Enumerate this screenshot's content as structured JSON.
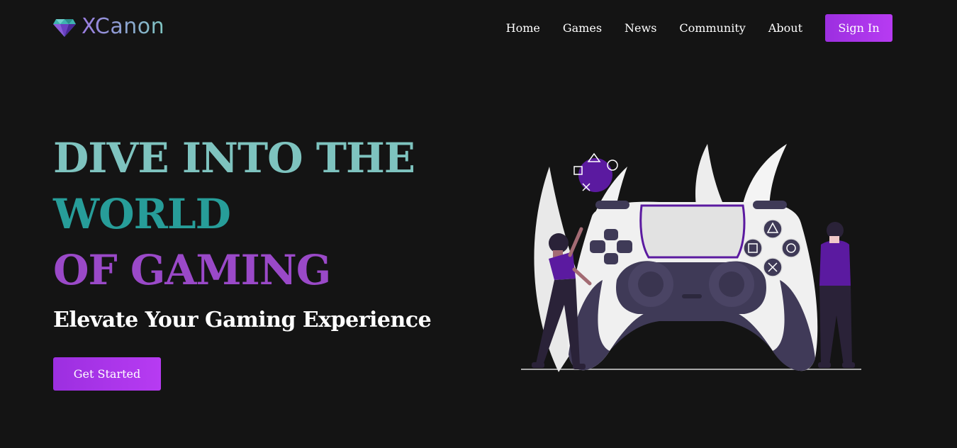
{
  "brand": {
    "name": "XCanon",
    "icon": "diamond-icon",
    "colors": [
      "#9a7be0",
      "#7fc7c2"
    ]
  },
  "nav": {
    "links": [
      "Home",
      "Games",
      "News",
      "Community",
      "About"
    ],
    "signin_label": "Sign In"
  },
  "hero": {
    "title_lines": [
      "DIVE INTO THE",
      "WORLD",
      "OF GAMING"
    ],
    "title_colors": [
      "#7ec3bf",
      "#279d99",
      "#9a49c8"
    ],
    "subtitle": "Elevate Your Gaming Experience",
    "cta_label": "Get Started"
  },
  "illustration": {
    "icon": "game-controller-illustration",
    "accent": "#5b1aa0"
  },
  "colors": {
    "background": "#141414",
    "accent": "#a832ea"
  }
}
